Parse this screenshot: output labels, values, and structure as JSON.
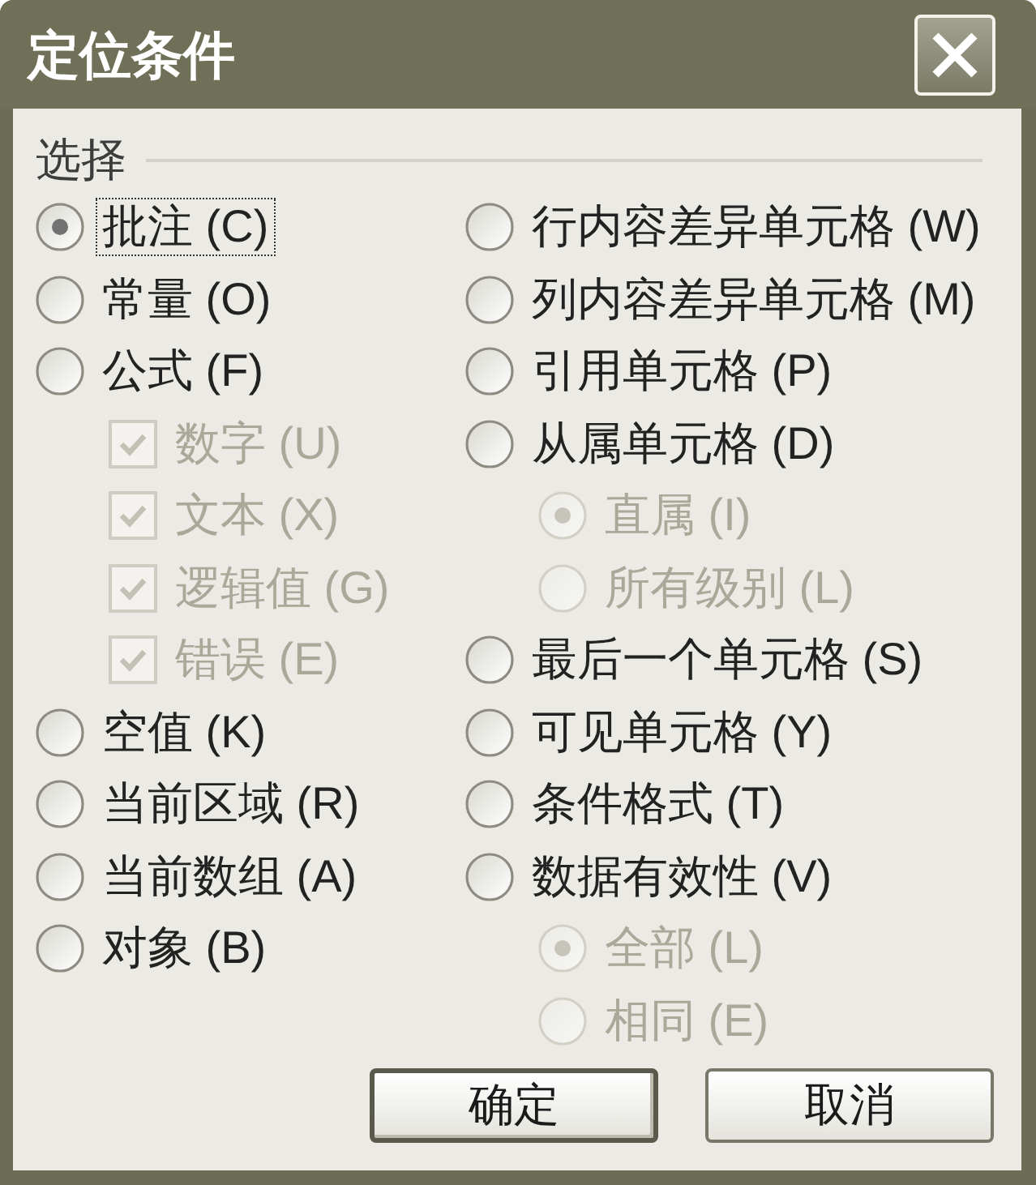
{
  "window": {
    "title": "定位条件"
  },
  "group": {
    "label": "选择"
  },
  "options_left": [
    {
      "kind": "radio",
      "label": "批注 (C)",
      "selected": true,
      "focused": true
    },
    {
      "kind": "radio",
      "label": "常量 (O)",
      "selected": false,
      "focused": false
    },
    {
      "kind": "radio",
      "label": "公式 (F)",
      "selected": false,
      "focused": false,
      "children": [
        {
          "kind": "checkbox",
          "label": "数字 (U)",
          "checked": true,
          "disabled": true
        },
        {
          "kind": "checkbox",
          "label": "文本 (X)",
          "checked": true,
          "disabled": true
        },
        {
          "kind": "checkbox",
          "label": "逻辑值 (G)",
          "checked": true,
          "disabled": true
        },
        {
          "kind": "checkbox",
          "label": "错误 (E)",
          "checked": true,
          "disabled": true
        }
      ]
    },
    {
      "kind": "radio",
      "label": "空值 (K)",
      "selected": false,
      "focused": false
    },
    {
      "kind": "radio",
      "label": "当前区域 (R)",
      "selected": false,
      "focused": false
    },
    {
      "kind": "radio",
      "label": "当前数组 (A)",
      "selected": false,
      "focused": false
    },
    {
      "kind": "radio",
      "label": "对象 (B)",
      "selected": false,
      "focused": false
    }
  ],
  "options_right": [
    {
      "kind": "radio",
      "label": "行内容差异单元格 (W)",
      "selected": false,
      "focused": false
    },
    {
      "kind": "radio",
      "label": "列内容差异单元格 (M)",
      "selected": false,
      "focused": false
    },
    {
      "kind": "radio",
      "label": "引用单元格 (P)",
      "selected": false,
      "focused": false
    },
    {
      "kind": "radio",
      "label": "从属单元格 (D)",
      "selected": false,
      "focused": false,
      "children": [
        {
          "kind": "radio",
          "label": "直属 (I)",
          "selected": true,
          "disabled": true
        },
        {
          "kind": "radio",
          "label": "所有级别 (L)",
          "selected": false,
          "disabled": true
        }
      ]
    },
    {
      "kind": "radio",
      "label": "最后一个单元格 (S)",
      "selected": false,
      "focused": false
    },
    {
      "kind": "radio",
      "label": "可见单元格 (Y)",
      "selected": false,
      "focused": false
    },
    {
      "kind": "radio",
      "label": "条件格式 (T)",
      "selected": false,
      "focused": false
    },
    {
      "kind": "radio",
      "label": "数据有效性 (V)",
      "selected": false,
      "focused": false,
      "children": [
        {
          "kind": "radio",
          "label": "全部 (L)",
          "selected": true,
          "disabled": true
        },
        {
          "kind": "radio",
          "label": "相同 (E)",
          "selected": false,
          "disabled": true
        }
      ]
    }
  ],
  "buttons": [
    {
      "label": "确定",
      "default": true
    },
    {
      "label": "取消",
      "default": false
    }
  ]
}
